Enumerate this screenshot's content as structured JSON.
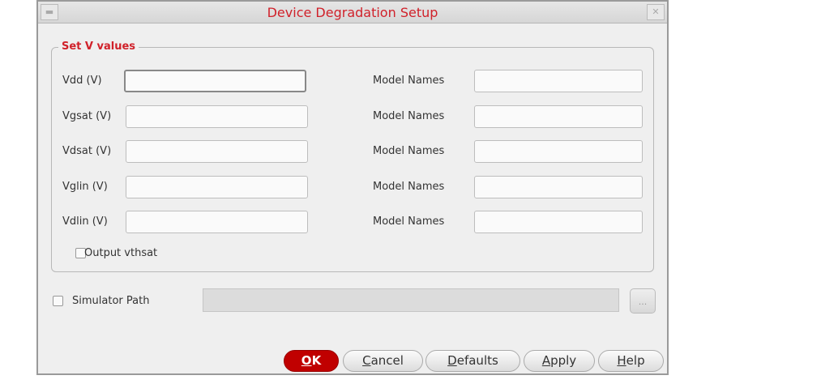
{
  "window": {
    "title": "Device Degradation Setup",
    "minimize_icon": "minimize-icon",
    "close_icon": "close-icon"
  },
  "group": {
    "title": "Set V values",
    "rows": [
      {
        "label": "Vdd (V)",
        "value": "",
        "model_label": "Model Names",
        "model_value": ""
      },
      {
        "label": "Vgsat (V)",
        "value": "",
        "model_label": "Model Names",
        "model_value": ""
      },
      {
        "label": "Vdsat (V)",
        "value": "",
        "model_label": "Model Names",
        "model_value": ""
      },
      {
        "label": "Vglin (V)",
        "value": "",
        "model_label": "Model Names",
        "model_value": ""
      },
      {
        "label": "Vdlin (V)",
        "value": "",
        "model_label": "Model Names",
        "model_value": ""
      }
    ],
    "output_vthsat": {
      "label": "Output vthsat",
      "checked": false
    }
  },
  "simulator": {
    "label": "Simulator Path",
    "checked": false,
    "value": "",
    "browse_label": "..."
  },
  "buttons": {
    "ok": {
      "u": "O",
      "rest": "K"
    },
    "cancel": {
      "u": "C",
      "rest": "ancel"
    },
    "defaults": {
      "u": "D",
      "rest": "efaults"
    },
    "apply": {
      "u": "A",
      "rest": "pply"
    },
    "help": {
      "u": "H",
      "rest": "elp"
    }
  }
}
